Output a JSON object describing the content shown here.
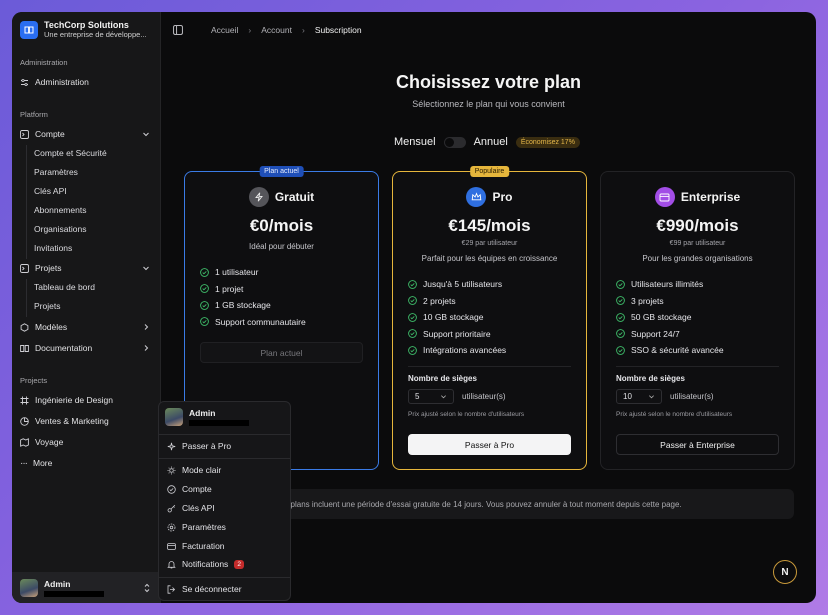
{
  "brand": {
    "name": "TechCorp Solutions",
    "subtitle": "Une entreprise de développe..."
  },
  "sidebar": {
    "section_admin": "Administration",
    "admin_item": "Administration",
    "section_platform": "Platform",
    "compte": "Compte",
    "compte_sub": [
      "Compte et Sécurité",
      "Paramètres",
      "Clés API",
      "Abonnements",
      "Organisations",
      "Invitations"
    ],
    "projets": "Projets",
    "projets_sub": [
      "Tableau de bord",
      "Projets"
    ],
    "modeles": "Modèles",
    "documentation": "Documentation",
    "section_projects": "Projects",
    "projects": [
      "Ingénierie de Design",
      "Ventes & Marketing",
      "Voyage"
    ],
    "more": "More",
    "user": "Admin"
  },
  "breadcrumb": {
    "home": "Accueil",
    "account": "Account",
    "current": "Subscription"
  },
  "header": {
    "title": "Choisissez votre plan",
    "subtitle": "Sélectionnez le plan qui vous convient"
  },
  "billing": {
    "monthly": "Mensuel",
    "annual": "Annuel",
    "discount": "Économisez 17%"
  },
  "plans": [
    {
      "badge": "Plan actuel",
      "name": "Gratuit",
      "price": "€0/mois",
      "desc": "Idéal pour débuter",
      "features": [
        "1 utilisateur",
        "1 projet",
        "1 GB stockage",
        "Support communautaire"
      ],
      "button": "Plan actuel",
      "accent": "#3a7be6"
    },
    {
      "badge": "Populaire",
      "name": "Pro",
      "price": "€145/mois",
      "per_user": "€29 par utilisateur",
      "desc": "Parfait pour les équipes en croissance",
      "features": [
        "Jusqu'à 5 utilisateurs",
        "2 projets",
        "10 GB stockage",
        "Support prioritaire",
        "Intégrations avancées"
      ],
      "seats_label": "Nombre de sièges",
      "seats_value": "5",
      "seats_unit": "utilisateur(s)",
      "seats_note": "Prix ajusté selon le nombre d'utilisateurs",
      "button": "Passer à Pro",
      "accent": "#e6b63c"
    },
    {
      "name": "Enterprise",
      "price": "€990/mois",
      "per_user": "€99 par utilisateur",
      "desc": "Pour les grandes organisations",
      "features": [
        "Utilisateurs illimités",
        "3 projets",
        "50 GB stockage",
        "Support 24/7",
        "SSO & sécurité avancée"
      ],
      "seats_label": "Nombre de sièges",
      "seats_value": "10",
      "seats_unit": "utilisateur(s)",
      "seats_note": "Prix ajusté selon le nombre d'utilisateurs",
      "button": "Passer à Enterprise",
      "accent": "#a24de6"
    }
  ],
  "footer_note": "s plans incluent une période d'essai gratuite de 14 jours. Vous pouvez annuler à tout moment depuis cette page.",
  "menu": {
    "user": "Admin",
    "upgrade": "Passer à Pro",
    "light_mode": "Mode clair",
    "account": "Compte",
    "api_keys": "Clés API",
    "settings": "Paramètres",
    "billing": "Facturation",
    "notifications": "Notifications",
    "notif_count": "2",
    "logout": "Se déconnecter"
  },
  "bubble": "N"
}
